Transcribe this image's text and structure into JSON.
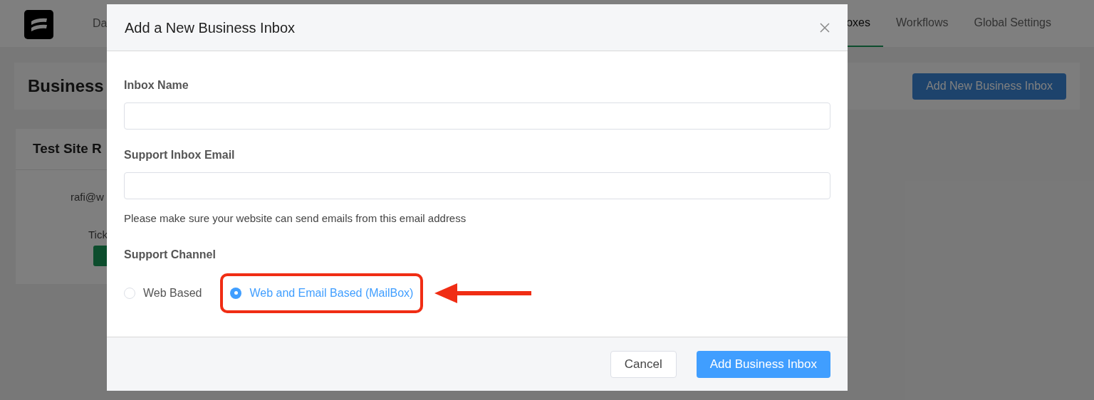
{
  "header": {
    "nav_left": "Da",
    "nav_right": [
      {
        "label": "oxes",
        "selected": true
      },
      {
        "label": "Workflows",
        "selected": false
      },
      {
        "label": "Global Settings",
        "selected": false
      }
    ]
  },
  "page": {
    "title": "Business",
    "action": "Add New Business Inbox"
  },
  "card": {
    "title": "Test Site R",
    "email": "rafi@w",
    "label": "Tick"
  },
  "dialog": {
    "title": "Add a New Business Inbox",
    "fields": [
      {
        "label": "Inbox Name"
      },
      {
        "label": "Support Inbox Email",
        "help": "Please make sure your website can send emails from this email address"
      }
    ],
    "channel": {
      "label": "Support Channel",
      "options": [
        {
          "label": "Web Based",
          "selected": false,
          "highlighted": false
        },
        {
          "label": "Web and Email Based (MailBox)",
          "selected": true,
          "highlighted": true
        }
      ]
    },
    "annotation_arrow": true,
    "buttons": [
      {
        "label": "Cancel",
        "kind": "secondary"
      },
      {
        "label": "Add Business Inbox",
        "kind": "primary"
      }
    ]
  }
}
